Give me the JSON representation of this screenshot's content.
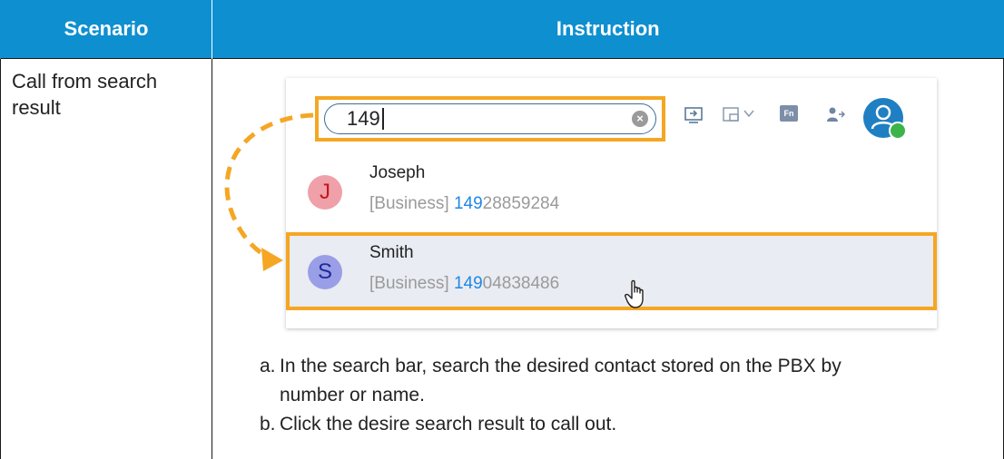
{
  "table": {
    "headers": {
      "scenario": "Scenario",
      "instruction": "Instruction"
    }
  },
  "scenario": {
    "text": "Call from search result"
  },
  "search": {
    "value": "149"
  },
  "toolbar": {
    "icons": [
      "screen-share-icon",
      "window-layout-icon",
      "chevron-down-icon",
      "fn-key-icon",
      "transfer-contact-icon",
      "user-avatar-icon"
    ],
    "fn_label": "Fn"
  },
  "results": [
    {
      "initial": "J",
      "name": "Joseph",
      "label": "[Business] ",
      "number_match": "149",
      "number_rest": "28859284"
    },
    {
      "initial": "S",
      "name": "Smith",
      "label": "[Business] ",
      "number_match": "149",
      "number_rest": "04838486"
    }
  ],
  "steps": [
    {
      "marker": "a.",
      "text": "In the search bar, search the desired contact stored on the PBX by",
      "text_cont": "number or name."
    },
    {
      "marker": "b.",
      "text": "Click the desire search result to call out."
    }
  ],
  "colors": {
    "header_bg": "#0e8fd0",
    "highlight": "#f5a623",
    "match": "#1e88e5",
    "status_online": "#3cb44a"
  }
}
